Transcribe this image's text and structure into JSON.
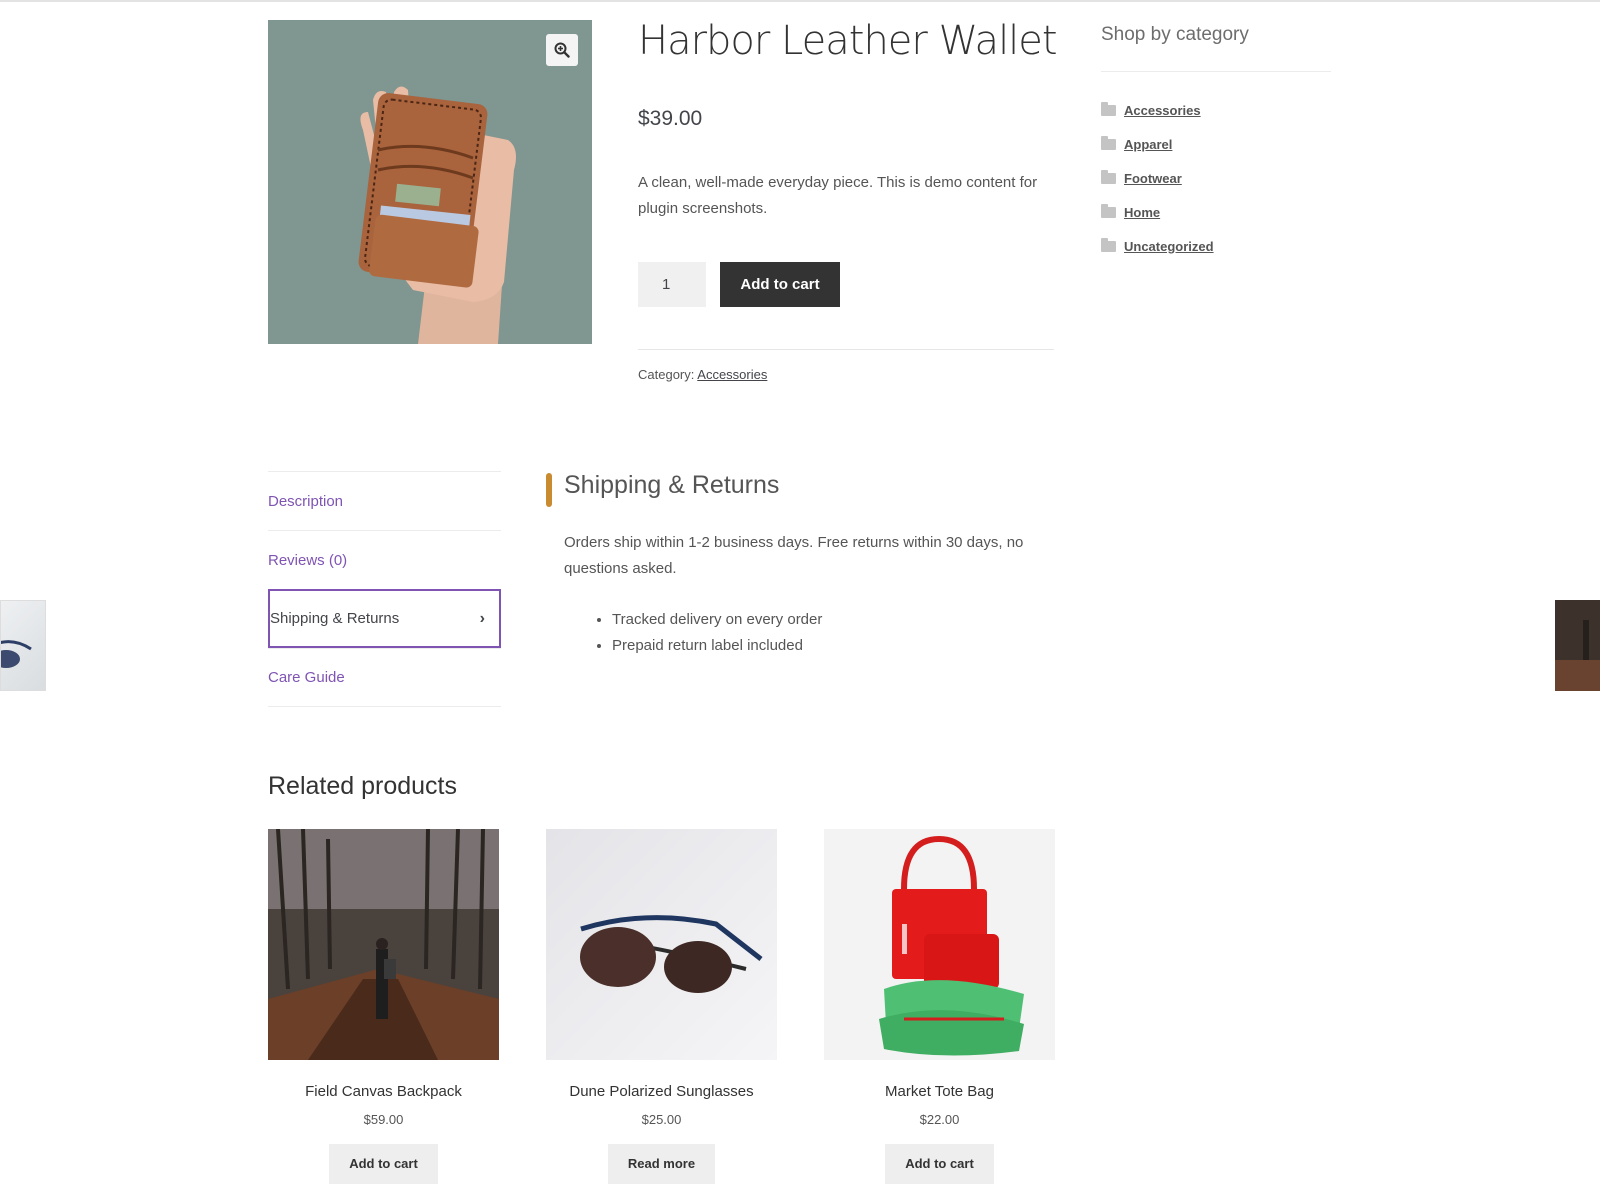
{
  "product": {
    "title": "Harbor Leather Wallet",
    "price": "$39.00",
    "short_description": "A clean, well-made everyday piece. This is demo content for plugin screenshots.",
    "quantity": "1",
    "add_to_cart_label": "Add to cart",
    "category_label": "Category:",
    "category_value": "Accessories",
    "image_alt": "leather-wallet-photo",
    "zoom_icon": "zoom-in-icon"
  },
  "sidebar": {
    "title": "Shop by category",
    "categories": [
      "Accessories",
      "Apparel",
      "Footwear",
      "Home",
      "Uncategorized"
    ],
    "icon": "folder-icon"
  },
  "tabs": {
    "items": [
      {
        "label": "Description"
      },
      {
        "label": "Reviews (0)"
      },
      {
        "label": "Shipping & Returns"
      },
      {
        "label": "Care Guide"
      }
    ],
    "active_index": 2,
    "active_icon": "chevron-right-icon"
  },
  "panel": {
    "title": "Shipping & Returns",
    "text": "Orders ship within 1-2 business days. Free returns within 30 days, no questions asked.",
    "bullets": [
      "Tracked delivery on every order",
      "Prepaid return label included"
    ]
  },
  "related": {
    "title": "Related products",
    "products": [
      {
        "name": "Field Canvas Backpack",
        "price": "$59.00",
        "button": "Add to cart"
      },
      {
        "name": "Dune Polarized Sunglasses",
        "price": "$25.00",
        "button": "Read more"
      },
      {
        "name": "Market Tote Bag",
        "price": "$22.00",
        "button": "Add to cart"
      }
    ]
  },
  "colors": {
    "accent_purple": "#7f54b3",
    "panel_accent": "#c98b2f",
    "button_dark": "#333333",
    "button_light": "#eeeeee"
  }
}
